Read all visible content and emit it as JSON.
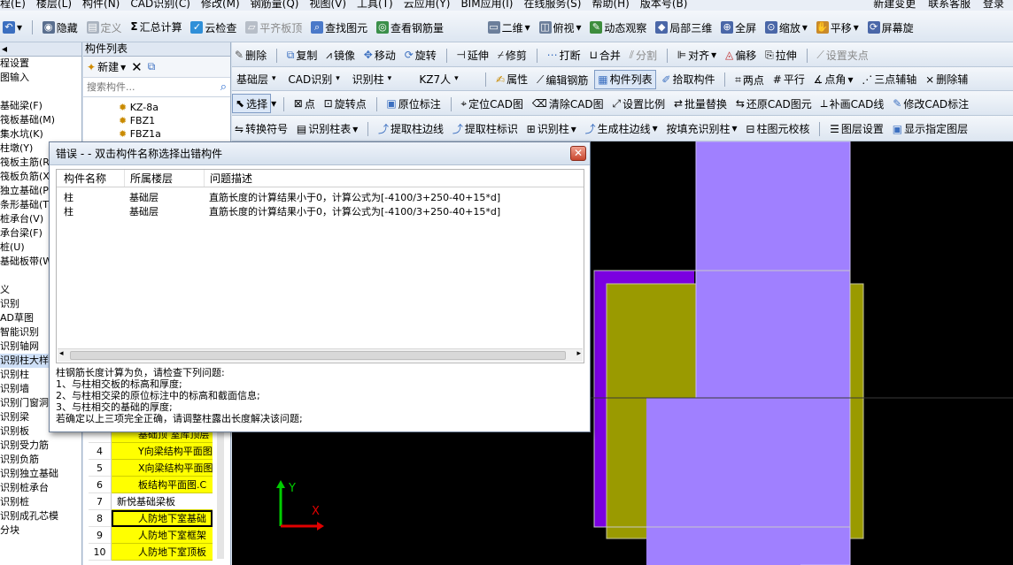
{
  "menubar": [
    "程(E)",
    "楼层(L)",
    "构件(N)",
    "CAD识别(C)",
    "修改(M)",
    "钢筋量(Q)",
    "视图(V)",
    "工具(T)",
    "云应用(Y)",
    "BIM应用(I)",
    "在线服务(S)",
    "帮助(H)",
    "版本号(B)"
  ],
  "menubar_right": [
    "新建变更",
    "联系客服",
    "登录"
  ],
  "toolbar1": {
    "hide": "隐藏",
    "define": "定义",
    "summary": "汇总计算",
    "cloud_check": "云检查",
    "flat_slab": "平齐板顶",
    "find": "查找图元",
    "view_rebar": "查看钢筋量",
    "view_2d": "二维",
    "top_view": "俯视",
    "dynamic": "动态观察",
    "local_3d": "局部三维",
    "fullscreen": "全屏",
    "zoom": "缩放",
    "pan": "平移",
    "screen": "屏幕旋"
  },
  "toolbar2": {
    "delete": "删除",
    "copy": "复制",
    "mirror": "镜像",
    "move": "移动",
    "rotate": "旋转",
    "extend": "延伸",
    "trim": "修剪",
    "break": "打断",
    "merge": "合并",
    "split": "分割",
    "align": "对齐",
    "offset": "偏移",
    "stretch": "拉伸",
    "set_grip": "设置夹点"
  },
  "toolbar3": {
    "floor": "基础层",
    "cad_identify": "CAD识别",
    "identify_col": "识别柱",
    "component": "KZ7人",
    "property": "属性",
    "edit_rebar": "编辑钢筋",
    "comp_list": "构件列表",
    "pick": "拾取构件",
    "two_point": "两点",
    "parallel": "平行",
    "point_angle": "点角",
    "three_point": "三点辅轴",
    "delete_aux": "删除辅"
  },
  "toolbar4": {
    "select": "选择",
    "point": "点",
    "rotate_point": "旋转点",
    "in_place": "原位标注",
    "locate_cad": "定位CAD图",
    "clear_cad": "清除CAD图",
    "set_scale": "设置比例",
    "batch_replace": "批量替换",
    "restore_cad": "还原CAD图元",
    "patch_cad": "补画CAD线",
    "modify_cad": "修改CAD标注"
  },
  "toolbar5": {
    "convert_symbol": "转换符号",
    "identify_table": "识别柱表",
    "extract_edge": "提取柱边线",
    "extract_mark": "提取柱标识",
    "identify_col": "识别柱",
    "gen_edge": "生成柱边线",
    "fill_identify": "按填充识别柱",
    "col_check": "柱图元校核",
    "layer_set": "图层设置",
    "show_component": "显示指定图层"
  },
  "leftpane": {
    "header": "构件列表",
    "items": [
      "程设置",
      "图输入",
      "",
      "基础梁(F)",
      "筏板基础(M)",
      "集水坑(K)",
      "柱墩(Y)",
      "筏板主筋(R)",
      "筏板负筋(X)",
      "独立基础(P)",
      "条形基础(T)",
      "桩承台(V)",
      "承台梁(F)",
      "桩(U)",
      "基础板带(W)",
      "",
      "义",
      "识别",
      "AD草图",
      "智能识别",
      "识别轴网",
      "识别柱大样",
      "识别柱",
      "识别墙",
      "识别门窗洞",
      "识别梁",
      "识别板",
      "识别受力筋",
      "识别负筋",
      "识别独立基础",
      "识别桩承台",
      "识别桩",
      "识别成孔芯模",
      "分块"
    ]
  },
  "midpane": {
    "new_label": "新建",
    "search_placeholder": "搜索构件...",
    "tree": [
      "KZ-8a",
      "FBZ1",
      "FBZ1a"
    ]
  },
  "table_rows": [
    {
      "n": "",
      "v": "基础顶 室库顶层"
    },
    {
      "n": "4",
      "v": "Y向梁结构平面图"
    },
    {
      "n": "5",
      "v": "X向梁结构平面图"
    },
    {
      "n": "6",
      "v": "板结构平面图.C"
    },
    {
      "n": "7",
      "v": "新悦基础梁板"
    },
    {
      "n": "8",
      "v": "人防地下室基础"
    },
    {
      "n": "9",
      "v": "人防地下室框架"
    },
    {
      "n": "10",
      "v": "人防地下室顶板"
    }
  ],
  "dialog": {
    "title": "错误 - - 双击构件名称选择出错构件",
    "columns": [
      "构件名称",
      "所属楼层",
      "问题描述"
    ],
    "rows": [
      {
        "name": "柱",
        "floor": "基础层",
        "desc": "直筋长度的计算结果小于0，计算公式为[-4100/3+250-40+15*d]"
      },
      {
        "name": "柱",
        "floor": "基础层",
        "desc": "直筋长度的计算结果小于0，计算公式为[-4100/3+250-40+15*d]"
      }
    ],
    "message": "柱钢筋长度计算为负，请检查下列问题:\n1、与柱相交板的标高和厚度;\n2、与柱相交梁的原位标注中的标高和截面信息;\n3、与柱相交的基础的厚度;\n若确定以上三项完全正确，请调整柱露出长度解决该问题;"
  },
  "axis": {
    "y": "Y",
    "x": "X"
  },
  "colors": {
    "purple": "#a080ff",
    "olive": "#9a9a00",
    "violet": "#7b00e0"
  }
}
